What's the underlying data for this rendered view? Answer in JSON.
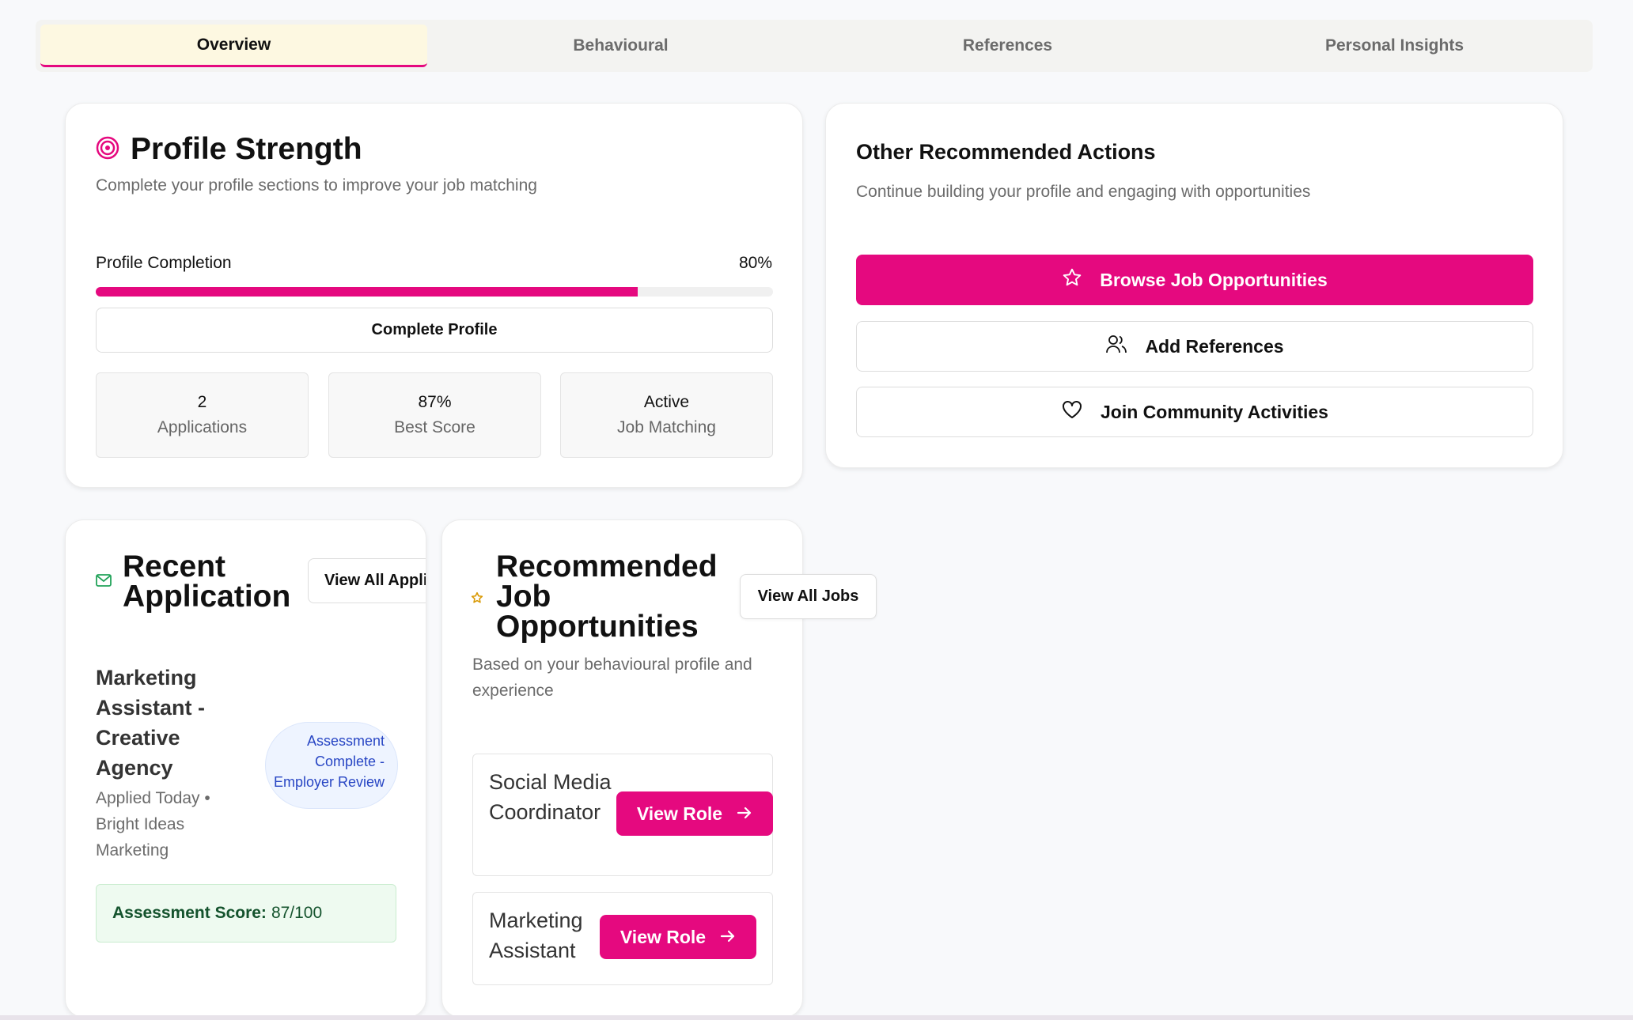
{
  "tabs": [
    "Overview",
    "Behavioural",
    "References",
    "Personal Insights"
  ],
  "profile_strength": {
    "title": "Profile Strength",
    "subtitle": "Complete your profile sections to improve your job matching",
    "completion_label": "Profile Completion",
    "completion_pct": "80%",
    "completion_value": 0.8,
    "complete_button": "Complete Profile",
    "stats": [
      {
        "value": "2",
        "label": "Applications"
      },
      {
        "value": "87%",
        "label": "Best Score"
      },
      {
        "value": "Active",
        "label": "Job Matching"
      }
    ]
  },
  "other_actions": {
    "title": "Other Recommended Actions",
    "subtitle": "Continue building your profile and engaging with opportunities",
    "browse": "Browse Job Opportunities",
    "add_references": "Add References",
    "join": "Join Community Activities"
  },
  "recent_application": {
    "title": "Recent Application",
    "view_all": "View All Applications",
    "job_title": "Marketing Assistant - Creative Agency",
    "meta": "Applied Today • Bright Ideas Marketing",
    "status": "Assessment Complete - Employer Review",
    "score_label": "Assessment Score:",
    "score_value": "87/100"
  },
  "recommended_jobs": {
    "title": "Recommended Job Opportunities",
    "view_all": "View All Jobs",
    "subtitle": "Based on your behavioural profile and experience",
    "jobs": [
      {
        "title": "Social Media Coordinator",
        "button": "View Role"
      },
      {
        "title": "Marketing Assistant",
        "button": "View Role"
      }
    ]
  },
  "colors": {
    "accent": "#e5097f",
    "active_tab_bg": "#fdf8e1",
    "success_bg": "#eefaf0",
    "badge_text": "#2846c4"
  }
}
